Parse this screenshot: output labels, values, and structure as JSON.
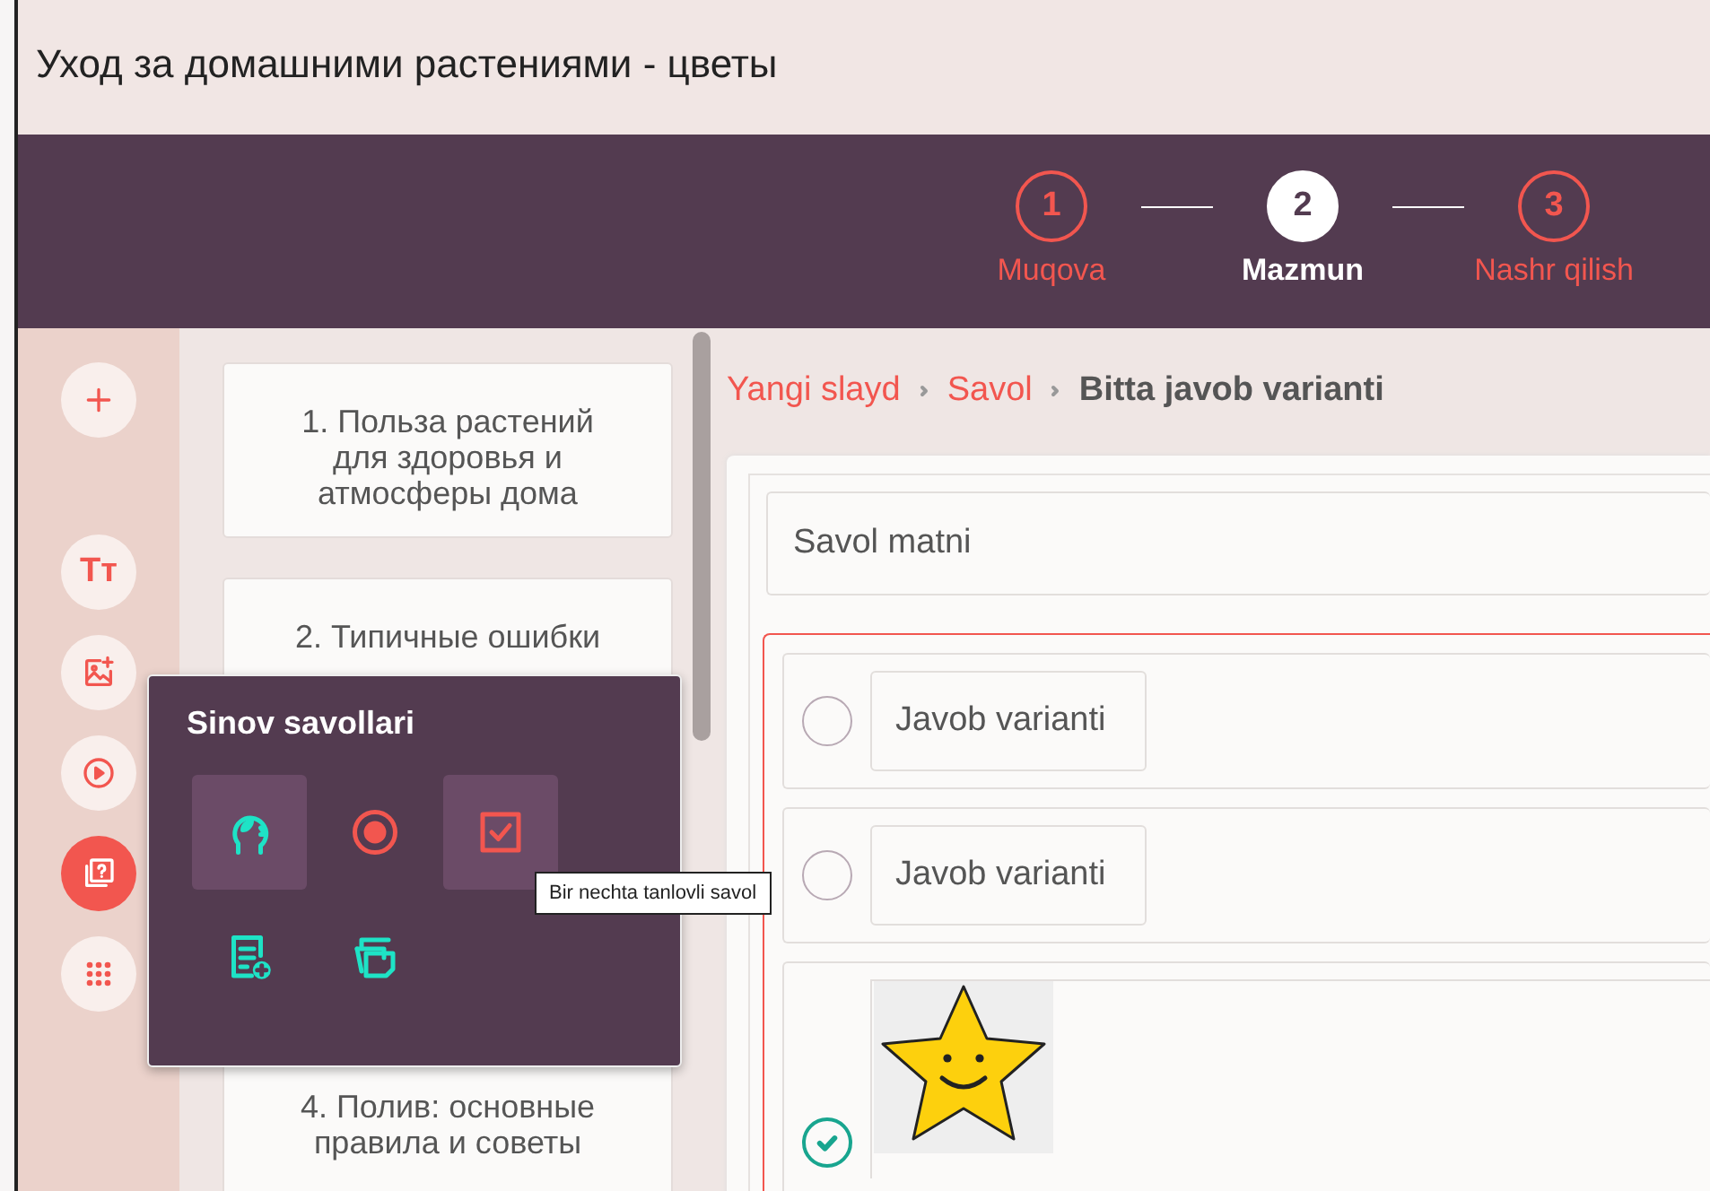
{
  "window": {
    "title": "Уход за домашними растениями - цветы"
  },
  "steps": [
    {
      "number": "1",
      "label": "Muqova",
      "selected": false
    },
    {
      "number": "2",
      "label": "Mazmun",
      "selected": true
    },
    {
      "number": "3",
      "label": "Nashr qilish",
      "selected": false
    }
  ],
  "toolbar": [
    {
      "kind": "add",
      "selected": false
    },
    {
      "kind": "text",
      "glyph": "Tт",
      "selected": false
    },
    {
      "kind": "image",
      "selected": false
    },
    {
      "kind": "video",
      "selected": false
    },
    {
      "kind": "quiz",
      "selected": true
    },
    {
      "kind": "more",
      "selected": false
    }
  ],
  "slides": [
    {
      "title": "1. Польза растений для здоровья и атмосферы дома"
    },
    {
      "title": "2. Типичные ошибки"
    },
    {
      "title": "4. Полив: основные правила и советы"
    }
  ],
  "popup": {
    "title": "Sinov savollari",
    "items": [
      {
        "kind": "mind",
        "highlighted": true
      },
      {
        "kind": "single",
        "highlighted": false
      },
      {
        "kind": "multiple",
        "highlighted": true
      },
      {
        "kind": "open",
        "highlighted": false
      },
      {
        "kind": "cards",
        "highlighted": false
      }
    ]
  },
  "tooltip": "Bir nechta tanlovli savol",
  "breadcrumb": [
    {
      "label": "Yangi slayd",
      "current": false
    },
    {
      "label": "Savol",
      "current": false
    },
    {
      "label": "Bitta javob varianti",
      "current": true
    }
  ],
  "question": {
    "placeholder": "Savol matni"
  },
  "answers": [
    {
      "kind": "text",
      "placeholder": "Javob varianti",
      "checked": false
    },
    {
      "kind": "text",
      "placeholder": "Javob varianti",
      "checked": false
    },
    {
      "kind": "image",
      "checked": true
    }
  ]
}
